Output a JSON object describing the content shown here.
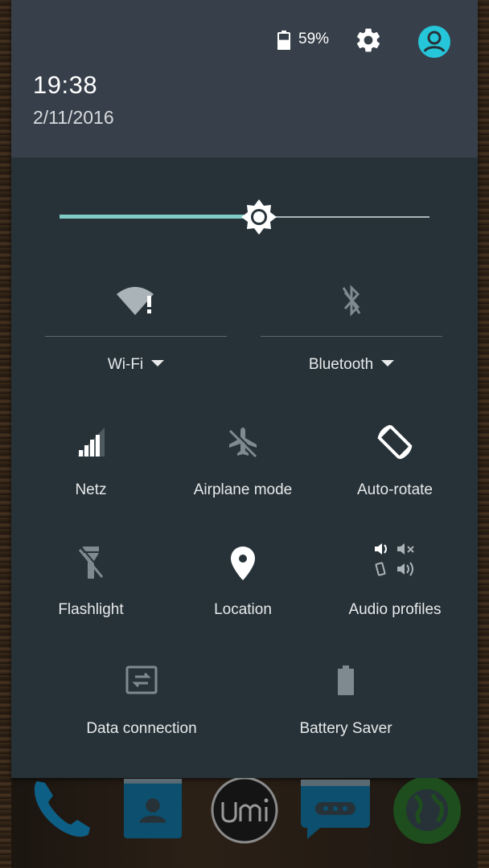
{
  "status": {
    "battery_percent": "59%",
    "battery_level": 0.59,
    "icons": [
      "battery-icon",
      "settings-gear-icon",
      "user-avatar-icon"
    ]
  },
  "header": {
    "time": "19:38",
    "date": "2/11/2016"
  },
  "brightness": {
    "level": 0.54,
    "accent_color": "#80cbc4"
  },
  "big_tiles": [
    {
      "id": "wifi",
      "label": "Wi-Fi",
      "icon": "wifi-warning-icon"
    },
    {
      "id": "bluetooth",
      "label": "Bluetooth",
      "icon": "bluetooth-off-icon"
    }
  ],
  "tiles": [
    {
      "id": "netz",
      "label": "Netz",
      "icon": "signal-icon"
    },
    {
      "id": "airplane",
      "label": "Airplane mode",
      "icon": "airplane-off-icon"
    },
    {
      "id": "autorotate",
      "label": "Auto-rotate",
      "icon": "auto-rotate-icon"
    },
    {
      "id": "flashlight",
      "label": "Flashlight",
      "icon": "flashlight-off-icon"
    },
    {
      "id": "location",
      "label": "Location",
      "icon": "location-pin-icon"
    },
    {
      "id": "audio",
      "label": "Audio profiles",
      "icon": "audio-profiles-icon"
    },
    {
      "id": "data",
      "label": "Data connection",
      "icon": "data-connection-icon"
    },
    {
      "id": "battery_saver",
      "label": "Battery Saver",
      "icon": "battery-saver-icon"
    }
  ],
  "dock": {
    "apps": [
      "phone-icon",
      "contacts-icon",
      "umi-logo-icon",
      "messaging-icon",
      "browser-icon"
    ]
  },
  "colors": {
    "panel": "#263238",
    "header": "#37404a",
    "icon_active": "#ffffff",
    "icon_inactive": "#7f8a90",
    "avatar": "#26c6da"
  }
}
